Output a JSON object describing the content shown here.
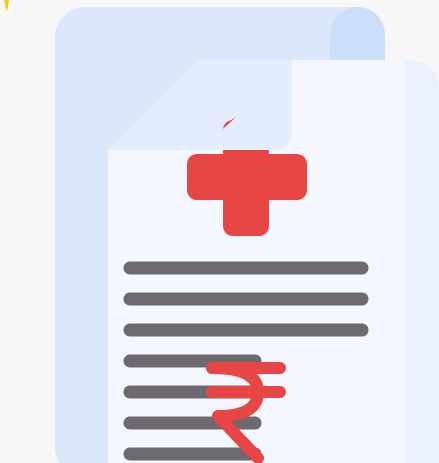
{
  "illustration": {
    "icon": "medical-bill-rupee-icon",
    "colors": {
      "background": "#f7f7f7",
      "back_page": "#dbe8fb",
      "back_page_edge": "#cbdff9",
      "front_page": "#f4f8fe",
      "front_page_right": "#e9f1fd",
      "fold": "#e3edfb",
      "cross": "#e84545",
      "cross_shadow": "#d63c3c",
      "text_line": "#6e6870",
      "rupee": "#e84545",
      "sparkle": "#f5c518"
    },
    "text_lines_full": 3,
    "text_lines_short": 4
  }
}
